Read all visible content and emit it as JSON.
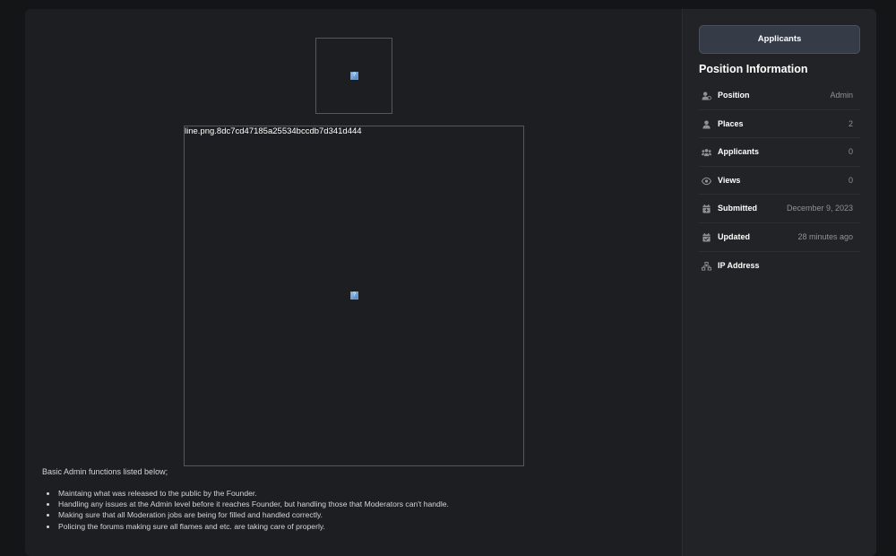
{
  "main": {
    "image_small": {
      "broken_glyph": "?"
    },
    "image_large": {
      "alt": "line.png.8dc7cd47185a25534bccdb7d341d444",
      "broken_glyph": "?"
    },
    "intro": "Basic Admin functions listed below;",
    "duties": [
      "Maintaing what was released to the public by the Founder.",
      "Handling any issues at the Admin level before it reaches Founder, but handling those that Moderators can't handle.",
      "Making sure that all Moderation jobs are being for filled and handled correctly.",
      "Policing the forums making sure all flames and etc. are taking care of properly."
    ]
  },
  "sidebar": {
    "applicants_button": "Applicants",
    "section_title": "Position Information",
    "rows": [
      {
        "icon": "user-tie-icon",
        "label": "Position",
        "value": "Admin"
      },
      {
        "icon": "person-icon",
        "label": "Places",
        "value": "2"
      },
      {
        "icon": "users-icon",
        "label": "Applicants",
        "value": "0"
      },
      {
        "icon": "eye-icon",
        "label": "Views",
        "value": "0"
      },
      {
        "icon": "calendar-plus-icon",
        "label": "Submitted",
        "value": "December 9, 2023"
      },
      {
        "icon": "calendar-check-icon",
        "label": "Updated",
        "value": "28 minutes ago"
      },
      {
        "icon": "network-icon",
        "label": "IP Address",
        "value": ""
      }
    ]
  },
  "colors": {
    "page_bg": "#141517",
    "panel_bg": "#1d1e21",
    "sidebar_bg": "#222326",
    "button_bg": "#353b47",
    "icon": "#8f9196"
  }
}
